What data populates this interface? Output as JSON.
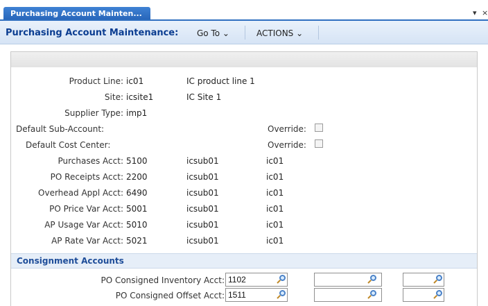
{
  "tab": {
    "label": "Purchasing Account Mainten...",
    "controls": [
      "▾",
      "×"
    ]
  },
  "menubar": {
    "title": "Purchasing Account Maintenance:",
    "goto": "Go To ⌄",
    "actions": "ACTIONS ⌄"
  },
  "form": {
    "product_line": {
      "label": "Product Line:",
      "value": "ic01",
      "desc": "IC product line 1"
    },
    "site": {
      "label": "Site:",
      "value": "icsite1",
      "desc": "IC Site 1"
    },
    "supplier_type": {
      "label": "Supplier Type:",
      "value": "imp1"
    },
    "default_sub_account": {
      "label": "Default Sub-Account:",
      "override_label": "Override:",
      "override_checked": false
    },
    "default_cost_center": {
      "label": "Default Cost Center:",
      "override_label": "Override:",
      "override_checked": false
    },
    "accounts": [
      {
        "label": "Purchases Acct:",
        "acct": "5100",
        "sub": "icsub01",
        "cc": "ic01"
      },
      {
        "label": "PO Receipts Acct:",
        "acct": "2200",
        "sub": "icsub01",
        "cc": "ic01"
      },
      {
        "label": "Overhead Appl Acct:",
        "acct": "6490",
        "sub": "icsub01",
        "cc": "ic01"
      },
      {
        "label": "PO Price Var Acct:",
        "acct": "5001",
        "sub": "icsub01",
        "cc": "ic01"
      },
      {
        "label": "AP Usage Var Acct:",
        "acct": "5010",
        "sub": "icsub01",
        "cc": "ic01"
      },
      {
        "label": "AP Rate Var Acct:",
        "acct": "5021",
        "sub": "icsub01",
        "cc": "ic01"
      }
    ]
  },
  "consignment": {
    "title": "Consignment Accounts",
    "rows": [
      {
        "label": "PO Consigned Inventory Acct:",
        "acct": "1102",
        "sub": "",
        "cc": ""
      },
      {
        "label": "PO Consigned Offset Acct:",
        "acct": "1511",
        "sub": "",
        "cc": ""
      }
    ]
  },
  "icons": {
    "lookup": "magnifier-lookup-icon",
    "tab_menu": "chevron-down-icon",
    "close": "close-icon"
  }
}
